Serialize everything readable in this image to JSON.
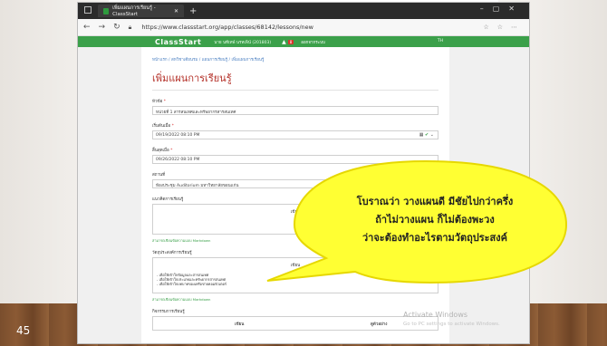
{
  "slide": {
    "number": "45"
  },
  "browser": {
    "tab_title": "เพิ่มแผนการเรียนรู้ - ClassStart",
    "url": "https://www.classstart.org/app/classes/68142/lessons/new"
  },
  "classstart": {
    "logo": "ClassStart",
    "user": "นาย นทีเทพ์ นรทเพิน์ (201803)",
    "badge": "8",
    "logout": "ออกจากระบบ",
    "lang": "TH"
  },
  "page": {
    "breadcrumb": "หน้าแรก / สหวิชาเดียนรม / แผนการเรียนรู้ / เพิ่มแผนการเรียนรู้",
    "title": "เพิ่มแผนการเรียนรู้",
    "fields": {
      "topic_label": "หัวข้อ",
      "topic_value": "หน่วยที่ 1 สารสนเทศและทรัพยากรสารสนเทศ",
      "start_label": "เริ่มต้นเมื่อ",
      "start_value": "09/19/2022 08:10 PM",
      "end_label": "สิ้นสุดเมื่อ",
      "end_value": "09/26/2022 08:10 PM",
      "place_label": "สถานที่",
      "place_value": "ห้องประชุม Auditorium มหาวิทยาลัยขอนแก่น",
      "concept_label": "แนวคิดการเรียนรู้",
      "editor_toolbar": "เขียน",
      "markdown_note": "สามารถเขียนข้อความแบบ Markdown",
      "objective_label": "วัตถุประสงค์การเรียนรู้",
      "objective_toolbar": "เขียน",
      "objective_items": [
        "- เพื่อให้เข้าใจข้อมูลและสารสนเทศ",
        "- เพื่อให้เข้าใจประเภทและทรัพยากรสารสนเทศ",
        "- เพื่อให้เข้าใจบทบาทของเครือข่ายคอมพิวเตอร์"
      ],
      "markdown_note2": "สามารถเขียนข้อความแบบ Markdown",
      "activity_label": "กิจกรรมการเรียนรู้",
      "activity_tool1": "เขียน",
      "activity_tool2": "ดูตัวอย่าง"
    }
  },
  "watermark": {
    "title": "Activate Windows",
    "sub": "Go to PC settings to activate Windows."
  },
  "callout": {
    "line1": "โบราณว่า วางแผนดี มีชัยไปกว่าครึ่ง",
    "line2": "ถ้าไม่วางแผน ก็ไม่ต้องพะวง",
    "line3": "ว่าจะต้องทำอะไรตามวัตถุประสงค์",
    "fill": "#ffff33",
    "stroke": "#e6d800"
  }
}
